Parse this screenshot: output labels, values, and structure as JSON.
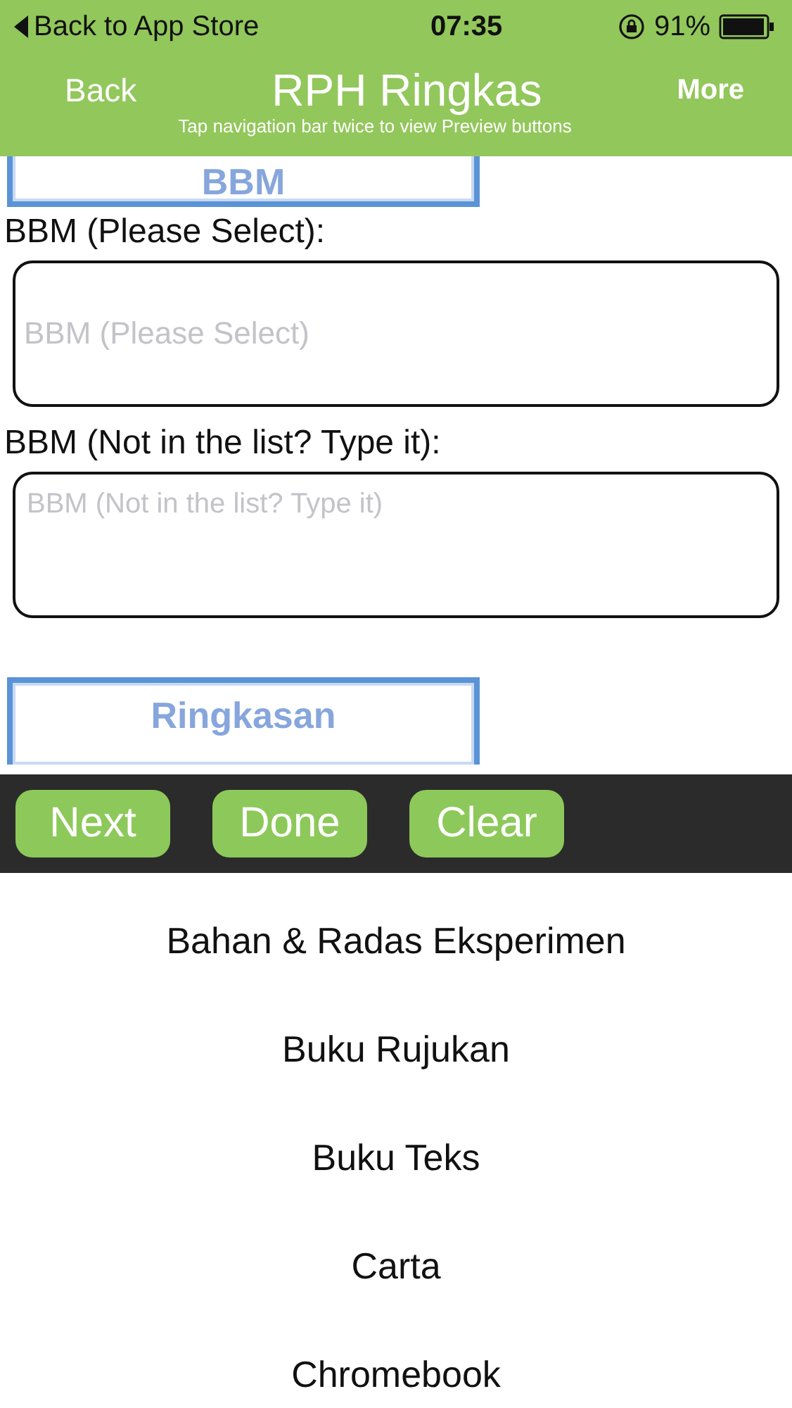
{
  "status_bar": {
    "back_link": "Back to App Store",
    "time": "07:35",
    "battery": "91%"
  },
  "nav_bar": {
    "back": "Back",
    "title": "RPH Ringkas",
    "more": "More",
    "hint": "Tap navigation bar twice to view Preview buttons"
  },
  "form": [
    {
      "kind": "banner",
      "lines": [
        "BBM"
      ]
    },
    {
      "kind": "label",
      "text": "BBM (Please Select):"
    },
    {
      "kind": "field",
      "placeholder": "BBM (Please Select)"
    },
    {
      "kind": "label",
      "text": "BBM (Not in the list? Type it):"
    },
    {
      "kind": "textarea",
      "placeholder": "BBM (Not in the list? Type it)"
    },
    {
      "kind": "banner",
      "lines": [
        "Ringkasan"
      ]
    }
  ],
  "toolbar": [
    "Next",
    "Done",
    "Clear"
  ],
  "picker": [
    "Bahan & Radas Eksperimen",
    "Buku Rujukan",
    "Buku Teks",
    "Carta",
    "Chromebook"
  ]
}
